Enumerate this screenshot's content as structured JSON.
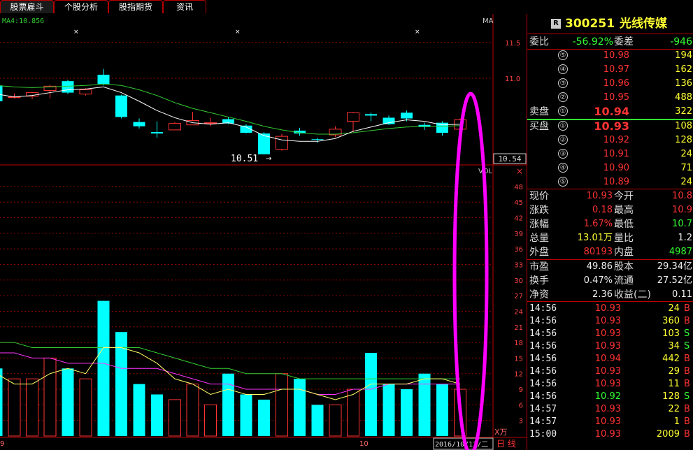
{
  "tabs": [
    "股票雇斗",
    "个股分析",
    "股指期货",
    "资讯"
  ],
  "indicator_label": "MA4:10.856",
  "ma_label": "MA",
  "vol_label": "VOL",
  "vol_unit": "X万",
  "price_axis": [
    "11.5",
    "11.0"
  ],
  "current_price_tag": "10.54",
  "low_annotation": "10.51",
  "vol_axis": [
    "48",
    "45",
    "42",
    "39",
    "36",
    "33",
    "30",
    "27",
    "24",
    "21",
    "18",
    "15",
    "12",
    "9",
    "6",
    "3"
  ],
  "bottom_bar": {
    "left_label": "9",
    "mid_label": "10",
    "date": "2016/10/1?/二",
    "period": "日 线"
  },
  "chart_data": {
    "type": "candlestick",
    "candles": [
      {
        "o": 10.9,
        "c": 10.68,
        "h": 10.92,
        "l": 10.65
      },
      {
        "o": 10.73,
        "c": 10.74,
        "h": 10.79,
        "l": 10.72
      },
      {
        "o": 10.75,
        "c": 10.8,
        "h": 10.81,
        "l": 10.71
      },
      {
        "o": 10.83,
        "c": 10.89,
        "h": 10.91,
        "l": 10.72
      },
      {
        "o": 10.96,
        "c": 10.8,
        "h": 10.98,
        "l": 10.78
      },
      {
        "o": 10.78,
        "c": 10.84,
        "h": 10.86,
        "l": 10.76
      },
      {
        "o": 11.05,
        "c": 10.92,
        "h": 11.13,
        "l": 10.9
      },
      {
        "o": 10.76,
        "c": 10.46,
        "h": 10.77,
        "l": 10.44
      },
      {
        "o": 10.39,
        "c": 10.33,
        "h": 10.44,
        "l": 10.3
      },
      {
        "o": 10.25,
        "c": 10.23,
        "h": 10.4,
        "l": 10.17
      },
      {
        "o": 10.28,
        "c": 10.37,
        "h": 10.39,
        "l": 10.28
      },
      {
        "o": 10.35,
        "c": 10.41,
        "h": 10.53,
        "l": 10.35
      },
      {
        "o": 10.38,
        "c": 10.38,
        "h": 10.45,
        "l": 10.33
      },
      {
        "o": 10.43,
        "c": 10.37,
        "h": 10.46,
        "l": 10.36
      },
      {
        "o": 10.34,
        "c": 10.24,
        "h": 10.36,
        "l": 10.23
      },
      {
        "o": 10.23,
        "c": 9.94,
        "h": 10.25,
        "l": 9.94
      },
      {
        "o": 10.01,
        "c": 10.19,
        "h": 10.22,
        "l": 9.99
      },
      {
        "o": 10.27,
        "c": 10.23,
        "h": 10.31,
        "l": 10.2
      },
      {
        "o": 10.15,
        "c": 10.14,
        "h": 10.17,
        "l": 10.1
      },
      {
        "o": 10.21,
        "c": 10.29,
        "h": 10.33,
        "l": 10.18
      },
      {
        "o": 10.4,
        "c": 10.52,
        "h": 10.53,
        "l": 10.25
      },
      {
        "o": 10.5,
        "c": 10.48,
        "h": 10.52,
        "l": 10.4
      },
      {
        "o": 10.45,
        "c": 10.36,
        "h": 10.48,
        "l": 10.35
      },
      {
        "o": 10.52,
        "c": 10.44,
        "h": 10.55,
        "l": 10.4
      },
      {
        "o": 10.35,
        "c": 10.32,
        "h": 10.38,
        "l": 10.28
      },
      {
        "o": 10.38,
        "c": 10.24,
        "h": 10.4,
        "l": 10.2
      },
      {
        "o": 10.29,
        "c": 10.42,
        "h": 10.44,
        "l": 10.15
      }
    ],
    "volume": [
      13,
      11,
      11,
      15,
      13,
      11,
      26,
      20,
      10,
      8,
      7,
      10,
      6,
      12,
      8,
      7,
      12,
      11,
      6,
      6,
      9,
      16,
      10,
      9,
      12,
      10,
      9
    ],
    "ma_fast": [
      10.78,
      10.74,
      10.76,
      10.8,
      10.84,
      10.85,
      10.88,
      10.8,
      10.68,
      10.55,
      10.45,
      10.38,
      10.36,
      10.38,
      10.32,
      10.2,
      10.14,
      10.12,
      10.12,
      10.16,
      10.26,
      10.32,
      10.38,
      10.42,
      10.4,
      10.35,
      10.36
    ],
    "ma_slow": [
      10.9,
      10.88,
      10.87,
      10.88,
      10.89,
      10.9,
      10.92,
      10.9,
      10.84,
      10.76,
      10.66,
      10.58,
      10.52,
      10.46,
      10.4,
      10.33,
      10.28,
      10.24,
      10.22,
      10.22,
      10.24,
      10.27,
      10.3,
      10.32,
      10.33,
      10.33,
      10.34
    ],
    "vol_ma_fast": [
      12,
      10,
      10,
      12,
      13,
      12,
      17,
      17,
      16,
      14,
      11,
      10,
      8,
      9,
      8,
      8,
      9,
      9,
      8,
      7,
      8,
      10,
      10,
      10,
      11,
      11,
      10
    ],
    "vol_ma_mid": [
      16,
      16,
      15,
      15,
      14,
      14,
      14,
      13,
      13,
      13,
      12,
      11,
      10,
      10,
      9,
      9,
      9,
      9,
      8,
      8,
      9,
      9,
      10,
      10,
      10,
      10,
      10
    ],
    "vol_ma_slow": [
      18,
      18,
      17,
      17,
      17,
      17,
      17,
      17,
      17,
      16,
      15,
      14,
      13,
      13,
      12,
      12,
      12,
      11,
      11,
      11,
      11,
      11,
      11,
      11,
      11,
      11,
      11
    ],
    "price_range": [
      9.85,
      11.8
    ],
    "vol_range": [
      0,
      50
    ]
  },
  "quote": {
    "badge": "R",
    "code": "300251",
    "name": "光线传媒",
    "weibi_label": "委比",
    "weibi": "-56.92%",
    "weicha_label": "委差",
    "weicha": "-946",
    "sell_label": "卖盘",
    "buy_label": "买盘",
    "asks": [
      {
        "n": "⑤",
        "p": "10.98",
        "v": "194"
      },
      {
        "n": "④",
        "p": "10.97",
        "v": "162"
      },
      {
        "n": "③",
        "p": "10.96",
        "v": "136"
      },
      {
        "n": "②",
        "p": "10.95",
        "v": "488"
      },
      {
        "n": "①",
        "p": "10.94",
        "v": "322"
      }
    ],
    "bids": [
      {
        "n": "①",
        "p": "10.93",
        "v": "108"
      },
      {
        "n": "②",
        "p": "10.92",
        "v": "128"
      },
      {
        "n": "③",
        "p": "10.91",
        "v": "24"
      },
      {
        "n": "④",
        "p": "10.90",
        "v": "71"
      },
      {
        "n": "⑤",
        "p": "10.89",
        "v": "24"
      }
    ],
    "stats": [
      {
        "l1": "现价",
        "v1": "10.93",
        "c1": "red",
        "l2": "今开",
        "v2": "10.8",
        "c2": "red"
      },
      {
        "l1": "涨跌",
        "v1": "0.18",
        "c1": "red",
        "l2": "最高",
        "v2": "10.9",
        "c2": "red"
      },
      {
        "l1": "涨幅",
        "v1": "1.67%",
        "c1": "red",
        "l2": "最低",
        "v2": "10.7",
        "c2": "green"
      },
      {
        "l1": "总量",
        "v1": "13.01万",
        "c1": "yellow",
        "l2": "量比",
        "v2": "1.2",
        "c2": "white"
      },
      {
        "l1": "外盘",
        "v1": "80193",
        "c1": "red",
        "l2": "内盘",
        "v2": "4987",
        "c2": "green"
      }
    ],
    "stats2": [
      {
        "l1": "市盈",
        "v1": "49.86",
        "l2": "股本",
        "v2": "29.34亿"
      },
      {
        "l1": "换手",
        "v1": "0.47%",
        "l2": "流通",
        "v2": "27.52亿"
      },
      {
        "l1": "净资",
        "v1": "2.36",
        "l2": "收益(二)",
        "v2": "0.11"
      }
    ],
    "ticks": [
      {
        "t": "14:56",
        "p": "10.93",
        "v": "24",
        "s": "B"
      },
      {
        "t": "14:56",
        "p": "10.93",
        "v": "360",
        "s": "B"
      },
      {
        "t": "14:56",
        "p": "10.93",
        "v": "103",
        "s": "S"
      },
      {
        "t": "14:56",
        "p": "10.93",
        "v": "34",
        "s": "S"
      },
      {
        "t": "14:56",
        "p": "10.94",
        "v": "442",
        "s": "B"
      },
      {
        "t": "14:56",
        "p": "10.93",
        "v": "29",
        "s": "B"
      },
      {
        "t": "14:56",
        "p": "10.93",
        "v": "11",
        "s": "B"
      },
      {
        "t": "14:56",
        "p": "10.92",
        "v": "128",
        "s": "S"
      },
      {
        "t": "14:57",
        "p": "10.93",
        "v": "22",
        "s": "B"
      },
      {
        "t": "14:57",
        "p": "10.93",
        "v": "1",
        "s": "B"
      },
      {
        "t": "15:00",
        "p": "10.93",
        "v": "2009",
        "s": "B"
      }
    ]
  },
  "colors": {
    "up": "#ff3333",
    "down": "#00ffff",
    "grid": "#8b0000",
    "ma_fast": "#ffffff",
    "ma_slow": "#33cc33",
    "vol_fast": "#ffff66",
    "vol_mid": "#ff33ff",
    "vol_slow": "#33cc33",
    "highlight": "#ff00ff"
  }
}
